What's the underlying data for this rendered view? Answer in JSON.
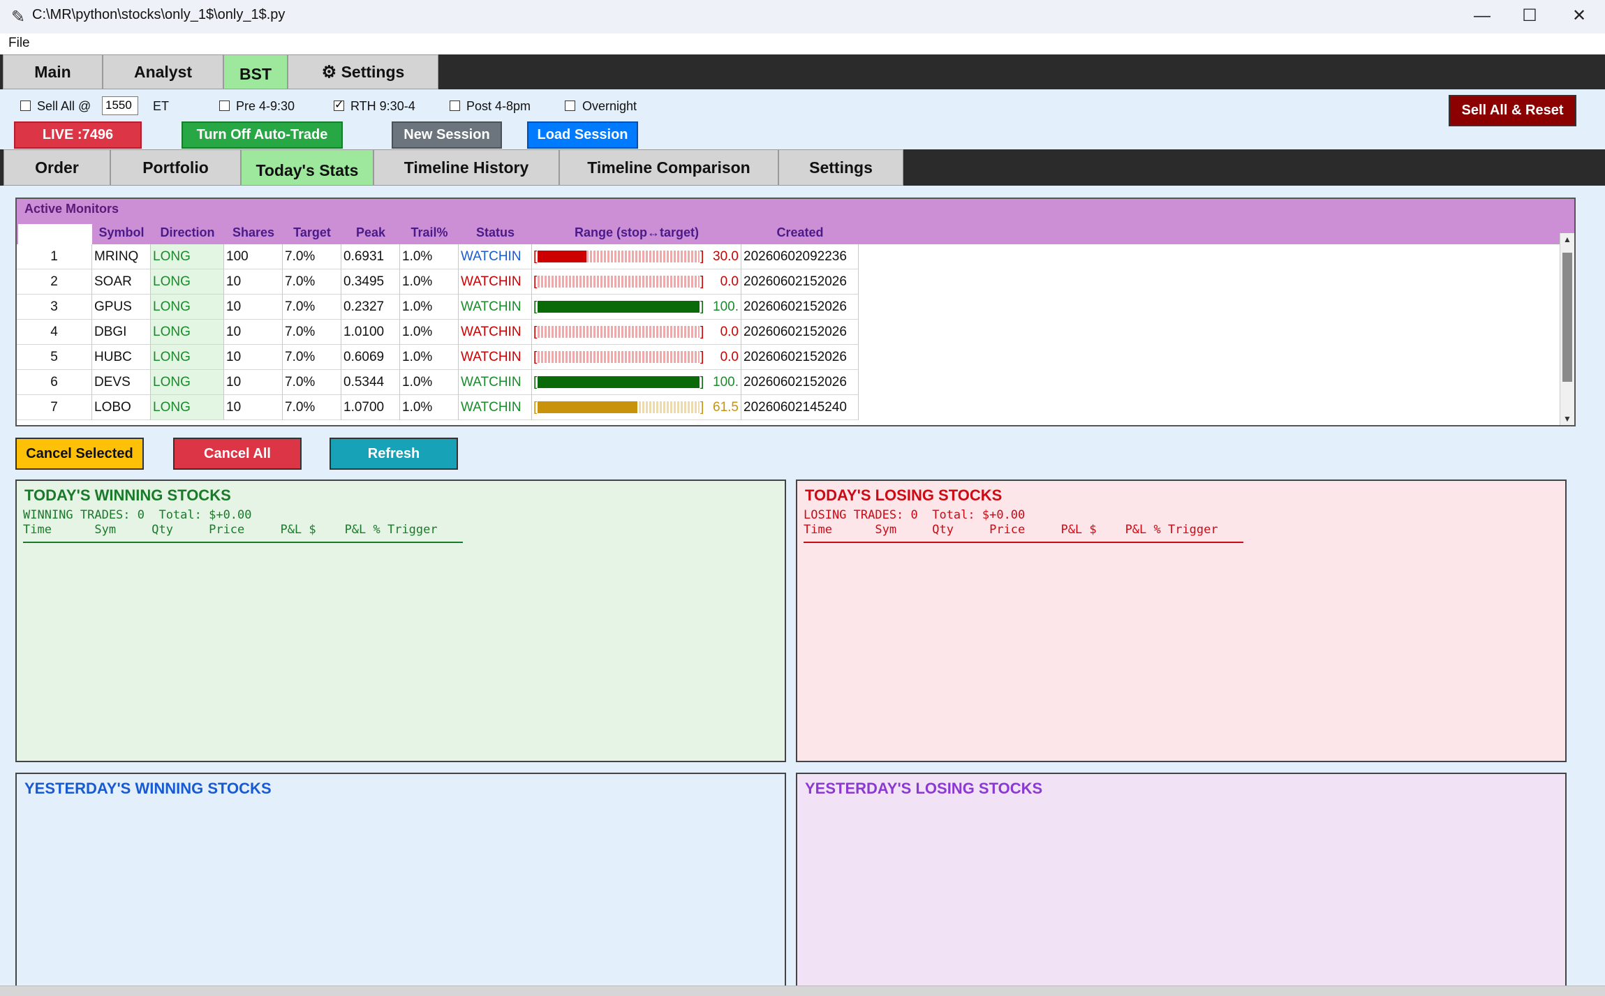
{
  "window": {
    "title": "C:\\MR\\python\\stocks\\only_1$\\only_1$.py"
  },
  "menu": {
    "file": "File"
  },
  "main_tabs": [
    {
      "label": "Main"
    },
    {
      "label": "Analyst"
    },
    {
      "label": "BST"
    },
    {
      "label": "Settings"
    }
  ],
  "options": {
    "sell_all_label": "Sell All @",
    "sell_all_time": "1550",
    "et_label": "ET",
    "pre_label": "Pre 4-9:30",
    "rth_label": "RTH 9:30-4",
    "post_label": "Post 4-8pm",
    "overnight_label": "Overnight",
    "rth_checked": "✓",
    "sell_reset_label": "Sell All & Reset"
  },
  "actions": {
    "live_label": "LIVE :7496",
    "autotrade_label": "Turn Off Auto-Trade",
    "new_session_label": "New Session",
    "load_session_label": "Load Session"
  },
  "sub_tabs": [
    {
      "label": "Order"
    },
    {
      "label": "Portfolio"
    },
    {
      "label": "Today's Stats"
    },
    {
      "label": "Timeline History"
    },
    {
      "label": "Timeline Comparison"
    },
    {
      "label": "Settings"
    }
  ],
  "monitors": {
    "title": "Active Monitors",
    "columns": [
      "Symbol",
      "Direction",
      "Shares",
      "Target",
      "Peak",
      "Trail%",
      "Status",
      "Range (stop↔target)",
      "Created"
    ],
    "rows": [
      {
        "n": "1",
        "symbol": "MRINQ",
        "direction": "LONG",
        "shares": "100",
        "target": "7.0%",
        "peak": "0.6931",
        "trail": "1.0%",
        "status": "WATCHIN",
        "range_pct": 0.3,
        "range_label": "30.0",
        "created": "20260602092236",
        "status_color": "#1a5ad0",
        "bar_color": "#cc0000",
        "label_color": "#cc0000"
      },
      {
        "n": "2",
        "symbol": "SOAR",
        "direction": "LONG",
        "shares": "10",
        "target": "7.0%",
        "peak": "0.3495",
        "trail": "1.0%",
        "status": "WATCHIN",
        "range_pct": 0.0,
        "range_label": "0.0",
        "created": "20260602152026",
        "status_color": "#cc0000",
        "bar_color": "#cc0000",
        "label_color": "#cc0000"
      },
      {
        "n": "3",
        "symbol": "GPUS",
        "direction": "LONG",
        "shares": "10",
        "target": "7.0%",
        "peak": "0.2327",
        "trail": "1.0%",
        "status": "WATCHIN",
        "range_pct": 1.0,
        "range_label": "100.",
        "created": "20260602152026",
        "status_color": "#1a8a2a",
        "bar_color": "#0a6a0a",
        "label_color": "#1a8a2a"
      },
      {
        "n": "4",
        "symbol": "DBGI",
        "direction": "LONG",
        "shares": "10",
        "target": "7.0%",
        "peak": "1.0100",
        "trail": "1.0%",
        "status": "WATCHIN",
        "range_pct": 0.0,
        "range_label": "0.0",
        "created": "20260602152026",
        "status_color": "#cc0000",
        "bar_color": "#cc0000",
        "label_color": "#cc0000"
      },
      {
        "n": "5",
        "symbol": "HUBC",
        "direction": "LONG",
        "shares": "10",
        "target": "7.0%",
        "peak": "0.6069",
        "trail": "1.0%",
        "status": "WATCHIN",
        "range_pct": 0.0,
        "range_label": "0.0",
        "created": "20260602152026",
        "status_color": "#cc0000",
        "bar_color": "#cc0000",
        "label_color": "#cc0000"
      },
      {
        "n": "6",
        "symbol": "DEVS",
        "direction": "LONG",
        "shares": "10",
        "target": "7.0%",
        "peak": "0.5344",
        "trail": "1.0%",
        "status": "WATCHIN",
        "range_pct": 1.0,
        "range_label": "100.",
        "created": "20260602152026",
        "status_color": "#1a8a2a",
        "bar_color": "#0a6a0a",
        "label_color": "#1a8a2a"
      },
      {
        "n": "7",
        "symbol": "LOBO",
        "direction": "LONG",
        "shares": "10",
        "target": "7.0%",
        "peak": "1.0700",
        "trail": "1.0%",
        "status": "WATCHIN",
        "range_pct": 0.615,
        "range_label": "61.5",
        "created": "20260602145240",
        "status_color": "#1a8a2a",
        "bar_color": "#c8930a",
        "label_color": "#c8930a"
      }
    ]
  },
  "monitor_actions": {
    "cancel_selected": "Cancel Selected",
    "cancel_all": "Cancel All",
    "refresh": "Refresh"
  },
  "today_win": {
    "title": "TODAY'S WINNING STOCKS",
    "summary": "WINNING TRADES: 0  Total: $+0.00",
    "header": "Time      Sym     Qty     Price     P&L $    P&L % Trigger"
  },
  "today_lose": {
    "title": "TODAY'S LOSING STOCKS",
    "summary": "LOSING TRADES: 0  Total: $+0.00",
    "header": "Time      Sym     Qty     Price     P&L $    P&L % Trigger"
  },
  "yest_win": {
    "title": "YESTERDAY'S WINNING STOCKS"
  },
  "yest_lose": {
    "title": "YESTERDAY'S LOSING STOCKS"
  },
  "colors": {
    "win_bg": "#e6f4e6",
    "win_text": "#1a7a2a",
    "lose_bg": "#fde6ea",
    "lose_text": "#cc0a14",
    "yw_bg": "#e3effa",
    "yw_text": "#1a5ad0",
    "yl_bg": "#f1e3f5",
    "yl_text": "#8a3ad0"
  }
}
